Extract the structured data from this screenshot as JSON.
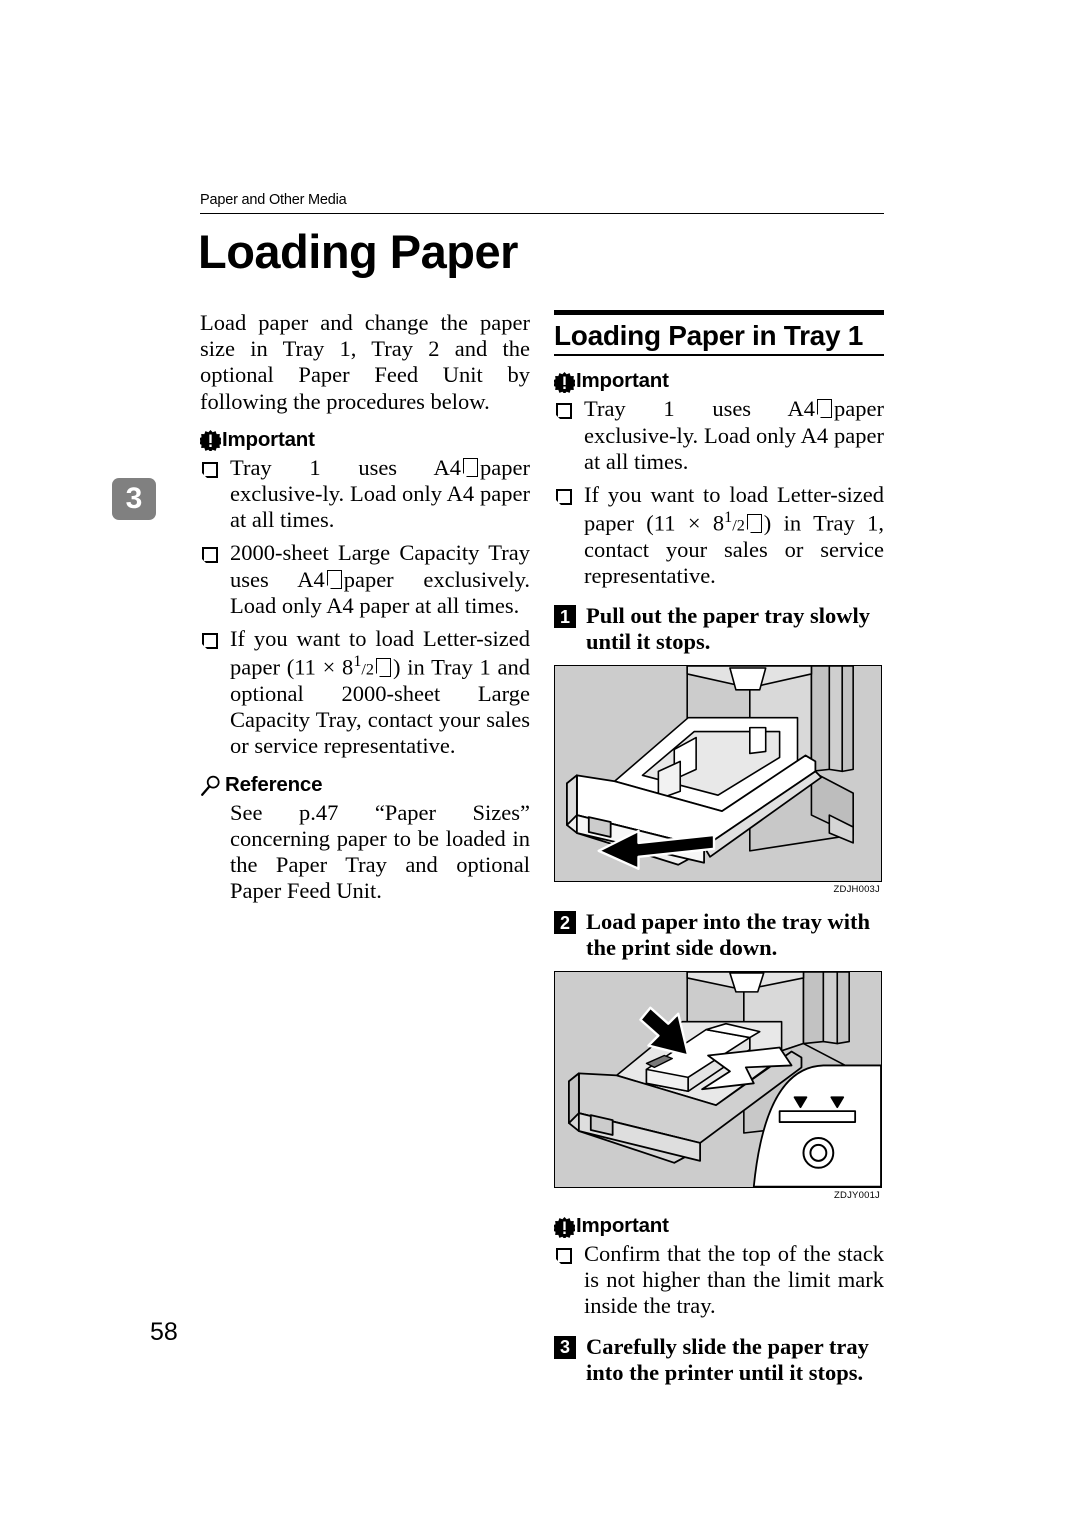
{
  "document": {
    "running_header": "Paper and Other Media",
    "chapter_tab": "3",
    "page_number": "58",
    "title": "Loading Paper"
  },
  "left_column": {
    "intro": "Load paper and change the paper size in Tray 1, Tray 2 and the optional Paper Feed Unit by following the procedures below.",
    "important": {
      "icon": "important-burst-icon",
      "label": "Important",
      "items": [
        "Tray 1 uses A4 ⏚ paper exclusively. Load only A4 paper at all times.",
        "2000-sheet Large Capacity Tray uses A4 ⏚ paper exclusively. Load only A4 paper at all times.",
        "If you want to load Letter-sized paper (11 × 8 1/2 ⏚) in Tray 1 and optional 2000-sheet Large Capacity Tray, contact your sales or service representative."
      ],
      "item1_pre": "Tray 1 uses A4",
      "item1_post": "paper exclusive-ly. Load only A4 paper at all times.",
      "item2_pre": "2000-sheet Large Capacity Tray uses A4",
      "item2_post": "paper exclusively. Load only A4 paper at all times.",
      "item3_pre": "If you want to load Letter-sized paper (11 × 8",
      "item3_sup": "1",
      "item3_frac": "/2",
      "item3_post": ") in Tray 1 and optional 2000-sheet Large Capacity Tray, contact your sales or service representative."
    },
    "reference": {
      "icon": "magnifier-icon",
      "label": "Reference",
      "text": "See p.47 “Paper Sizes” concerning paper to be loaded in the Paper Tray and optional Paper Feed Unit."
    }
  },
  "right_column": {
    "heading": "Loading Paper in Tray 1",
    "important_top": {
      "icon": "important-burst-icon",
      "label": "Important",
      "item1_pre": "Tray 1 uses A4",
      "item1_post": "paper exclusive-ly. Load only A4 paper at all times.",
      "item2_pre": "If you want to load Letter-sized paper (11 × 8",
      "item2_sup": "1",
      "item2_frac": "/2",
      "item2_post": ") in Tray 1, contact your sales or service representative."
    },
    "steps": [
      {
        "number": "1",
        "text": "Pull out the paper tray slowly until it stops.",
        "figure_code": "ZDJH003J",
        "figure_name": "paper-tray-pull-out-illustration"
      },
      {
        "number": "2",
        "text": "Load paper into the tray with the print side down.",
        "figure_code": "ZDJY001J",
        "figure_name": "load-paper-into-tray-illustration"
      },
      {
        "number": "3",
        "text": "Carefully slide the paper tray into the printer until it stops.",
        "figure_code": "",
        "figure_name": ""
      }
    ],
    "important_bottom": {
      "icon": "important-burst-icon",
      "label": "Important",
      "item1": "Confirm that the top of the stack is not higher than the limit mark inside the tray."
    }
  },
  "colors": {
    "illustration_background": "#cccccc",
    "chapter_tab_background": "#808080",
    "rule": "#000000"
  }
}
